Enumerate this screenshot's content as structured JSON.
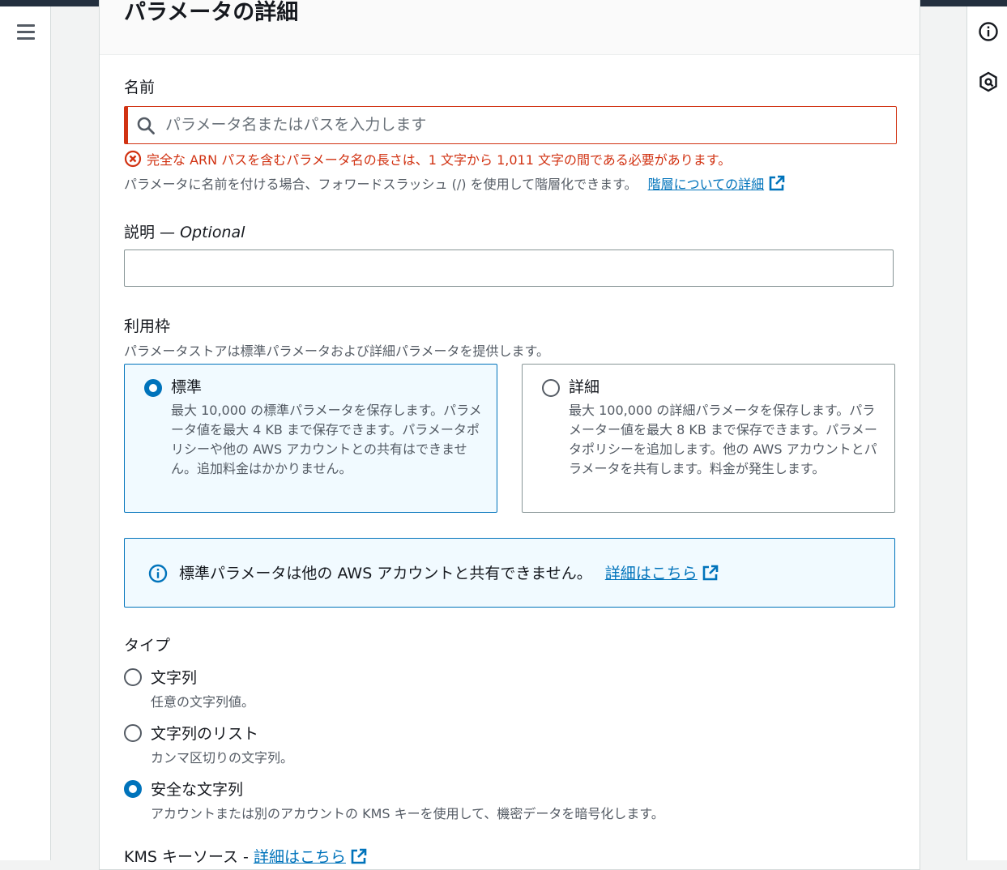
{
  "panel": {
    "title": "パラメータの詳細"
  },
  "name_field": {
    "label": "名前",
    "placeholder": "パラメータ名またはパスを入力します",
    "value": "",
    "error": "完全な ARN パスを含むパラメータ名の長さは、1 文字から 1,011 文字の間である必要があります。",
    "hint": "パラメータに名前を付ける場合、フォワードスラッシュ (/) を使用して階層化できます。",
    "hint_link": "階層についての詳細"
  },
  "description_field": {
    "label": "説明 —",
    "optional": "Optional",
    "value": ""
  },
  "tier": {
    "label": "利用枠",
    "hint": "パラメータストアは標準パラメータおよび詳細パラメータを提供します。",
    "options": [
      {
        "title": "標準",
        "description": "最大 10,000 の標準パラメータを保存します。パラメータ値を最大 4 KB まで保存できます。パラメータポリシーや他の AWS アカウントとの共有はできません。追加料金はかかりません。",
        "selected": true
      },
      {
        "title": "詳細",
        "description": "最大 100,000 の詳細パラメータを保存します。パラメーター値を最大 8 KB まで保存できます。パラメータポリシーを追加します。他の AWS アカウントとパラメータを共有します。料金が発生します。",
        "selected": false
      }
    ]
  },
  "info_alert": {
    "text": "標準パラメータは他の AWS アカウントと共有できません。",
    "link": "詳細はこちら"
  },
  "type": {
    "label": "タイプ",
    "options": [
      {
        "title": "文字列",
        "description": "任意の文字列値。",
        "selected": false
      },
      {
        "title": "文字列のリスト",
        "description": "カンマ区切りの文字列。",
        "selected": false
      },
      {
        "title": "安全な文字列",
        "description": "アカウントまたは別のアカウントの KMS キーを使用して、機密データを暗号化します。",
        "selected": true
      }
    ]
  },
  "kms": {
    "label": "KMS キーソース -",
    "link": "詳細はこちら"
  },
  "colors": {
    "error": "#d13212",
    "link": "#0073bb",
    "selected_bg": "#f1faff",
    "topbar": "#232f3e"
  }
}
